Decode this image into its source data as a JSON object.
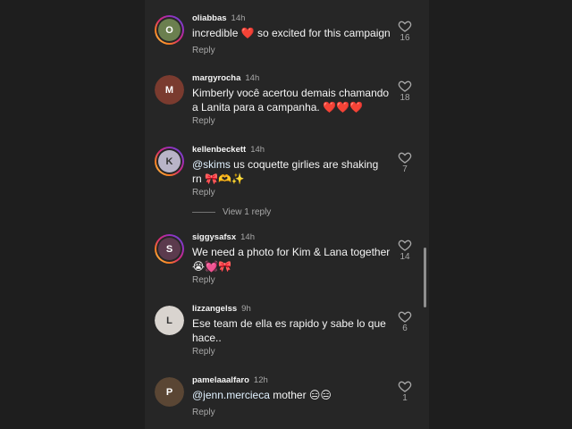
{
  "comments": [
    {
      "username": "oliabbas",
      "time": "14h",
      "text": "incredible ❤️ so excited for this campaign",
      "reply": "Reply",
      "likes": "16",
      "avatar_color": "#6b7f4f",
      "avatar_initial": "O"
    },
    {
      "username": "margyrocha",
      "time": "14h",
      "text": "Kimberly você acertou demais chamando a Lanita para a campanha. ❤️❤️❤️",
      "reply": "Reply",
      "likes": "18",
      "avatar_color": "#7a3b2f",
      "avatar_initial": "M"
    },
    {
      "username": "kellenbeckett",
      "time": "14h",
      "mention": "@skims",
      "text": " us coquette girlies are shaking rn 🎀🫶✨",
      "reply": "Reply",
      "likes": "7",
      "avatar_color": "#b9b4c8",
      "avatar_initial": "K"
    },
    {
      "username": "siggysafsx",
      "time": "14h",
      "text": "We need a photo for Kim & Lana together 😭💓🎀",
      "reply": "Reply",
      "likes": "14",
      "avatar_color": "#5b3a4d",
      "avatar_initial": "S"
    },
    {
      "username": "lizzangelss",
      "time": "9h",
      "text": "Ese team de ella es rapido y sabe lo que hace..",
      "reply": "Reply",
      "likes": "6",
      "avatar_color": "#d9d4cf",
      "avatar_initial": "L"
    },
    {
      "username": "pamelaaalfaro",
      "time": "12h",
      "mention": "@jenn.mercieca",
      "text": " mother 😑😑",
      "reply": "Reply",
      "likes": "1",
      "avatar_color": "#5a4634",
      "avatar_initial": "P"
    }
  ],
  "view_replies": "View 1 reply",
  "colors": {
    "background": "#262626",
    "muted": "#a8a8a8",
    "ring": "instagram-gradient"
  },
  "icons": {
    "like": "heart-outline-icon"
  }
}
